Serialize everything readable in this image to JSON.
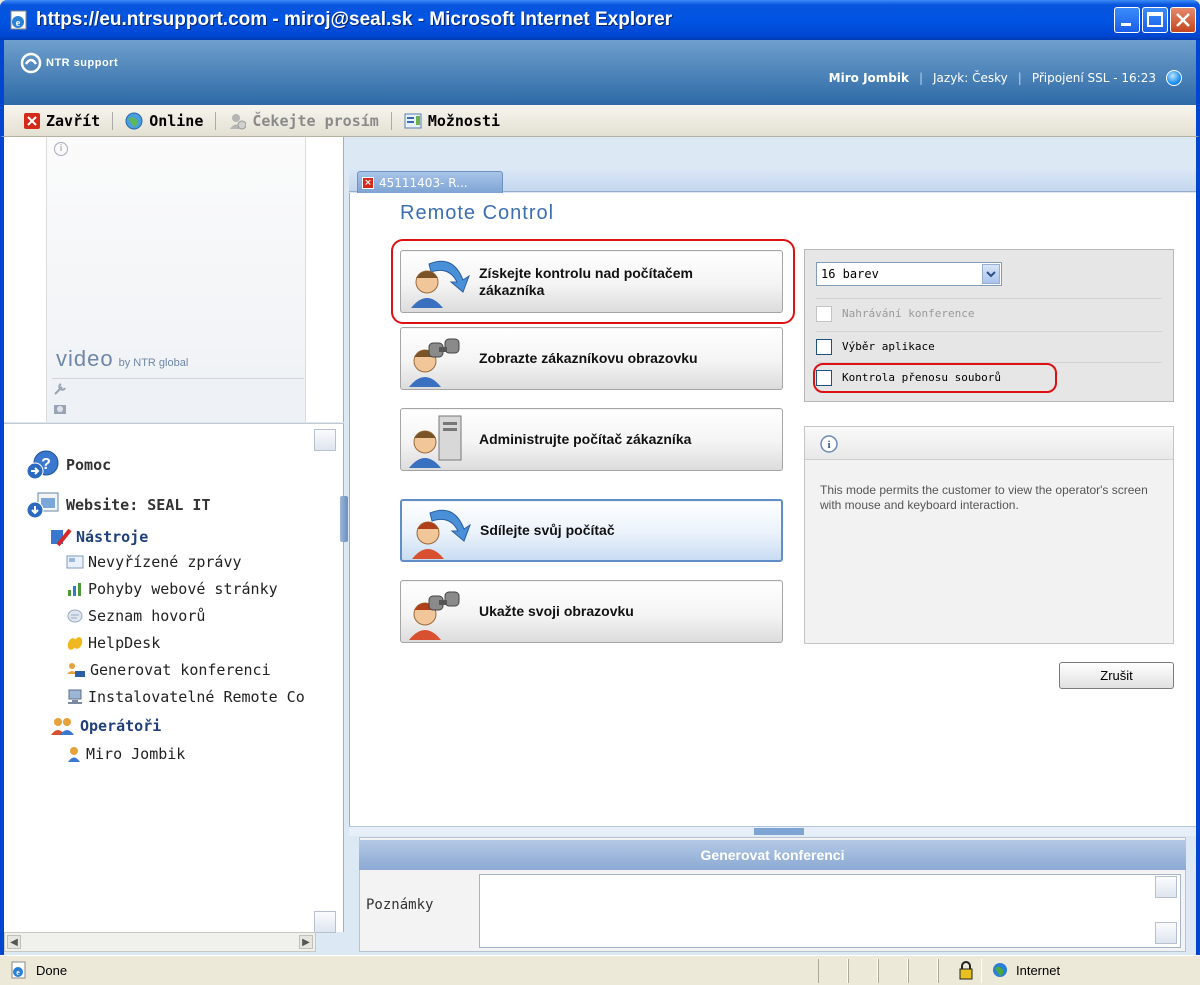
{
  "window": {
    "title": "https://eu.ntrsupport.com - miroj@seal.sk - Microsoft Internet Explorer"
  },
  "header": {
    "logo_text": "NTR support",
    "user": "Miro Jombik",
    "language": "Jazyk: Česky",
    "connection": "Připojení SSL - 16:23"
  },
  "toolbar": {
    "close_label": "Zavřít",
    "online_label": "Online",
    "waiting_label": "Čekejte prosím",
    "options_label": "Možnosti"
  },
  "video": {
    "logo_big": "video",
    "logo_small": "by NTR global"
  },
  "tree": {
    "help": "Pomoc",
    "website": "Website: SEAL IT",
    "tools": "Nástroje",
    "tool_items": [
      "Nevyřízené zprávy",
      "Pohyby webové stránky",
      "Seznam hovorů",
      "HelpDesk",
      "Generovat konferenci",
      "Instalovatelné Remote Co"
    ],
    "operators": "Operátoři",
    "operator_items": [
      "Miro Jombik"
    ]
  },
  "tab": {
    "label": "45111403- R..."
  },
  "remote": {
    "title": "Remote Control",
    "modes": [
      {
        "line1": "Získejte kontrolu nad počítačem",
        "line2": "zákazníka"
      },
      {
        "line1": "Zobrazte zákazníkovu obrazovku",
        "line2": ""
      },
      {
        "line1": "Administrujte počítač zákazníka",
        "line2": ""
      },
      {
        "line1": "Sdílejte svůj počítač",
        "line2": ""
      },
      {
        "line1": "Ukažte svoji obrazovku",
        "line2": ""
      }
    ]
  },
  "options": {
    "color_depth": "16 barev",
    "record": "Nahrávání konference",
    "app_select": "Výběr aplikace",
    "file_transfer": "Kontrola přenosu souborů"
  },
  "info": {
    "text": "This mode permits the customer to view the operator's screen with mouse and keyboard interaction."
  },
  "actions": {
    "cancel": "Zrušit"
  },
  "conference": {
    "title": "Generovat konferenci",
    "notes_label": "Poznámky",
    "notes_value": ""
  },
  "status": {
    "text": "Done",
    "zone": "Internet"
  }
}
